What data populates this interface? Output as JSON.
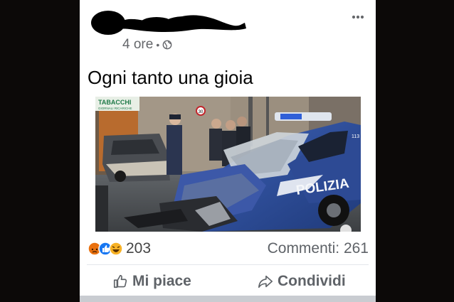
{
  "post": {
    "timestamp": "4 ore",
    "separator": "•",
    "text": "Ogni tanto una gioia",
    "more_icon": "more-dots-icon",
    "audience_icon": "globe-icon"
  },
  "photo": {
    "sign_shop": "TABACCHI",
    "sign_shop_sub": "GIORNALI  RICARICHE",
    "speed_limit": "30",
    "car_text": "POLIZIA",
    "car_text_top": "113"
  },
  "engagement": {
    "reaction_count": "203",
    "comments": "Commenti: 261",
    "reaction_icons": [
      "angry-icon",
      "like-icon",
      "haha-icon"
    ]
  },
  "actions": {
    "like": "Mi piace",
    "share": "Condividi"
  },
  "colors": {
    "background": "#0c0908",
    "card": "#ffffff",
    "muted_text": "#65676b",
    "like_blue": "#1877f2",
    "angry": "#e9710f",
    "haha": "#f7b125"
  }
}
